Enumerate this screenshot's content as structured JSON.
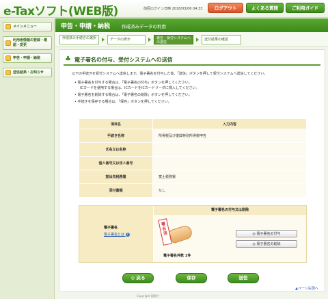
{
  "header": {
    "logo": "e-Taxソフト(WEB版)",
    "last_login": "前回ログイン日時 2018/03/06 04:33",
    "logout_label": "ログアウト",
    "faq_label": "よくある質問",
    "guide_label": "ご利用ガイド"
  },
  "sidebar": {
    "items": [
      {
        "label": "メインメニュー"
      },
      {
        "label": "利用者情報の登録・確認・変更"
      },
      {
        "label": "申告・申請・納税"
      },
      {
        "label": "送信結果・お知らせ"
      }
    ]
  },
  "titlebar": {
    "title": "申告・申請・納税",
    "subtitle": "作成済みデータの利用"
  },
  "steps": [
    {
      "label": "作成済み手続きの選択",
      "active": false
    },
    {
      "label": "データの表示",
      "active": false
    },
    {
      "label": "署名・受付システムへの送信",
      "active": true
    },
    {
      "label": "送付結果の確認",
      "active": false
    }
  ],
  "page": {
    "title": "電子署名の付与、受付システムへの送信",
    "intro": "以下の手続きを受付システムへ送信します。電子署名を付与した後、「送信」ボタンを押して受付システムへ送信してください。",
    "bullets": [
      "電子署名を付与する場合は、「電子署名の付与」ボタンを押してください。",
      "ICカードを使用する場合は、ICカードをICカードリーダに挿入してください。",
      "電子署名を削除する場合は、「電子署名の削除」ボタンを押してください。",
      "手続きを保存する場合は、「保存」ボタンを押してください。"
    ]
  },
  "info_table": {
    "header_item": "項目名",
    "header_value": "入力内容",
    "rows": [
      {
        "label": "手続き名称",
        "value": "所得税及び復興特別所得税申告"
      },
      {
        "label": "氏名又は名称",
        "value": ""
      },
      {
        "label": "個人番号又は法人番号",
        "value": ""
      },
      {
        "label": "提出先税務署",
        "value": "富士税務署"
      },
      {
        "label": "添付書類",
        "value": "なし"
      }
    ]
  },
  "signature": {
    "header": "電子署名の付与又は削除",
    "left_label": "電子署名",
    "left_link": "電子署名とは",
    "stamp_text": "署名済",
    "count": "電子署名件数 1件",
    "add_label": "電子署名の付与",
    "delete_label": "電子署名の削除"
  },
  "buttons": {
    "back": "戻る",
    "save": "保存",
    "send": "送信"
  },
  "pagetop": "ページ先頭へ",
  "footer": "Copyright 国税庁"
}
